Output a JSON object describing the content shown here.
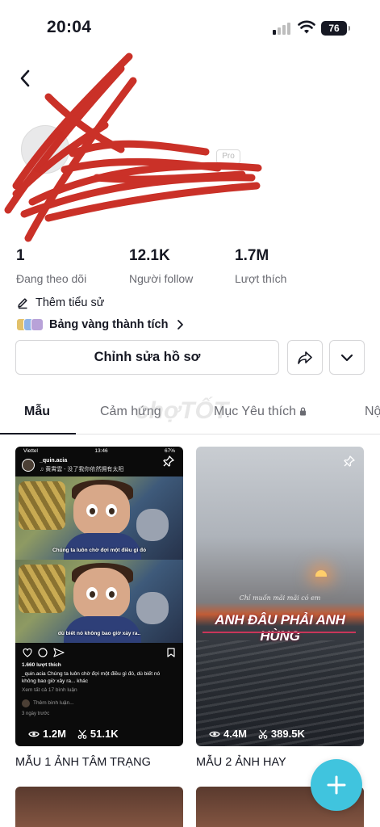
{
  "status_bar": {
    "time": "20:04",
    "battery": "76"
  },
  "profile": {
    "pro_badge": "Pro"
  },
  "stats": [
    {
      "number": "1",
      "label": "Đang theo dõi"
    },
    {
      "number": "12.1K",
      "label": "Người follow"
    },
    {
      "number": "1.7M",
      "label": "Lượt thích"
    }
  ],
  "bio_link": "Thêm tiểu sử",
  "badges_label": "Bảng vàng thành tích",
  "buttons": {
    "edit_profile": "Chỉnh sửa hồ sơ"
  },
  "tabs": [
    {
      "label": "Mẫu",
      "active": true
    },
    {
      "label": "Cảm hứng",
      "active": false
    },
    {
      "label": "Mục Yêu thích",
      "active": false
    },
    {
      "label": "Nộ",
      "active": false
    }
  ],
  "watermark": "chợTỐT",
  "cards": [
    {
      "title": "MẪU 1 ẢNH TÂM TRẠNG",
      "uses": "1.2M",
      "cuts": "51.1K",
      "preview": {
        "carrier": "Viettel",
        "clock": "13:46",
        "battery": "67%",
        "username": "_quin.acia",
        "music": "♫ 黄霄雲 - 没了我你依然拥有太阳",
        "caption_top": "Chúng ta luôn chờ đợi một điều gì đó",
        "caption_bottom": "dù biết nó không bao giờ xảy ra..",
        "likes": "1.660 lượt thích",
        "caption_text": "_quin.acia Chúng ta luôn chờ đợi một điều gì đó, dù biết nó không bao giờ xảy ra... khác",
        "view_comments": "Xem tất cả 17 bình luận",
        "add_comment": "Thêm bình luận...",
        "date": "3 ngày trước"
      }
    },
    {
      "title": "MẪU 2 ẢNH HAY",
      "uses": "4.4M",
      "cuts": "389.5K",
      "preview": {
        "small_text": "Chỉ muốn mãi mãi có em",
        "big_text": "ANH ĐÂU PHẢI ANH HÙNG"
      }
    }
  ],
  "colors": {
    "accent": "#40c4de",
    "text": "#161823",
    "muted": "#6a6b72",
    "scribble": "#c8261d"
  }
}
